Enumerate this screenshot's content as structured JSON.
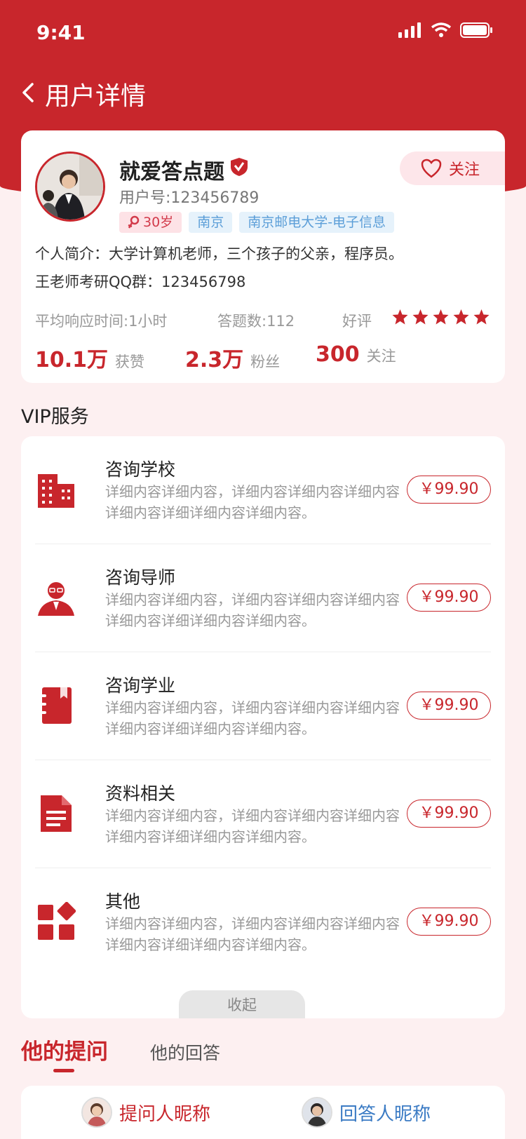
{
  "status": {
    "time": "9:41"
  },
  "nav": {
    "title": "用户详情"
  },
  "profile": {
    "name": "就爱答点题",
    "user_id": "用户号:123456789",
    "age_tag": "30岁",
    "city_tag": "南京",
    "school_tag": "南京邮电大学-电子信息",
    "follow_label": "关注",
    "bio": "个人简介：大学计算机老师，三个孩子的父亲，程序员。",
    "qq_group": "王老师考研QQ群：123456798",
    "avg_response": "平均响应时间:1小时",
    "answer_count": "答题数:112",
    "rating_label": "好评",
    "rating": 5,
    "likes_value": "10.1万",
    "likes_label": "获赞",
    "fans_value": "2.3万",
    "fans_label": "粉丝",
    "following_value": "300",
    "following_label": "关注"
  },
  "vip": {
    "title": "VIP服务",
    "services": [
      {
        "name": "咨询学校",
        "desc": "详细内容详细内容，详细内容详细内容详细内容详细内容详细详细内容详细内容。",
        "price": "￥99.90",
        "icon": "building-icon"
      },
      {
        "name": "咨询导师",
        "desc": "详细内容详细内容，详细内容详细内容详细内容详细内容详细详细内容详细内容。",
        "price": "￥99.90",
        "icon": "teacher-icon"
      },
      {
        "name": "咨询学业",
        "desc": "详细内容详细内容，详细内容详细内容详细内容详细内容详细详细内容详细内容。",
        "price": "￥99.90",
        "icon": "notebook-icon"
      },
      {
        "name": "资料相关",
        "desc": "详细内容详细内容，详细内容详细内容详细内容详细内容详细详细内容详细内容。",
        "price": "￥99.90",
        "icon": "document-icon"
      },
      {
        "name": "其他",
        "desc": "详细内容详细内容，详细内容详细内容详细内容详细内容详细详细内容详细内容。",
        "price": "￥99.90",
        "icon": "apps-icon"
      }
    ],
    "collapse_label": "收起"
  },
  "tabs": {
    "questions": "他的提问",
    "answers": "他的回答"
  },
  "qa": {
    "asker": "提问人昵称",
    "answerer": "回答人昵称"
  },
  "colors": {
    "accent": "#c8262c",
    "background": "#fdf0f1",
    "tag_blue": "#5b9ed8"
  }
}
